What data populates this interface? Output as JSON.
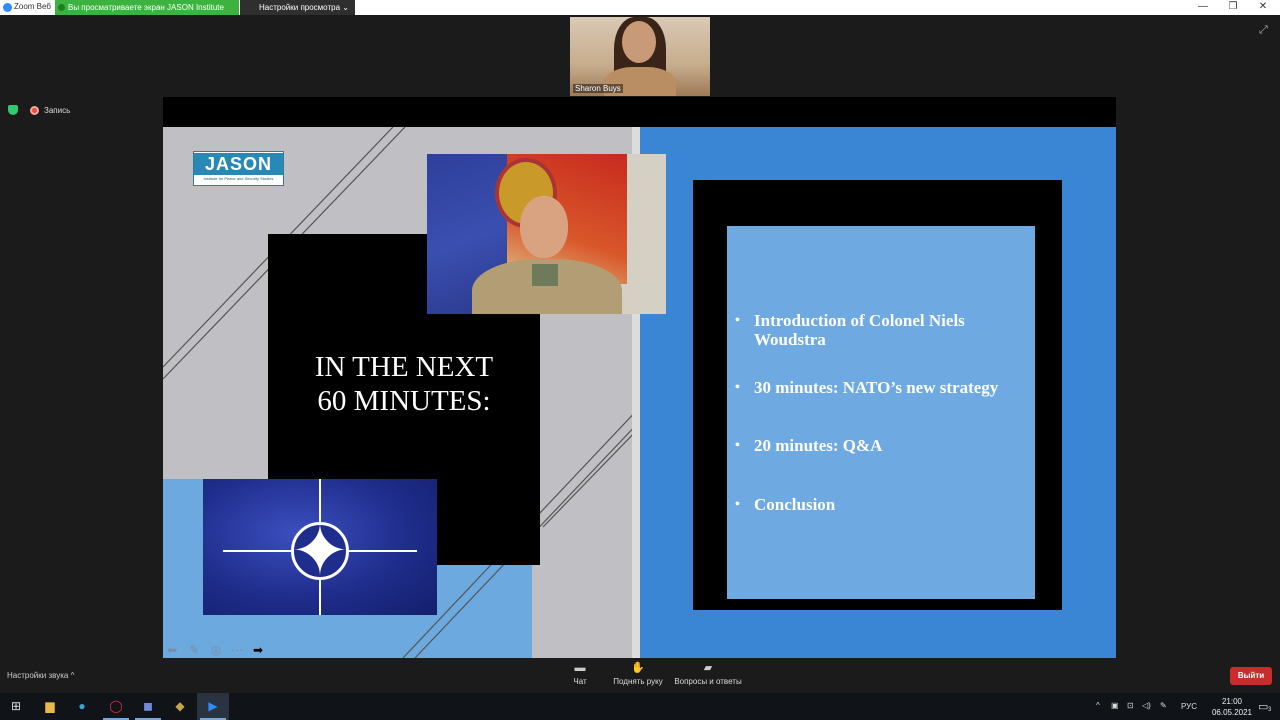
{
  "window": {
    "app_title": "Zoom Веб",
    "share_banner": "Вы просматриваете экран JASON Institute",
    "view_settings": "Настройки просмотра",
    "view_settings_chevron": "⌄",
    "minimize": "—",
    "maximize": "❐",
    "close": "✕"
  },
  "recording": {
    "label": "Запись"
  },
  "speaker": {
    "name": "Sharon Buys"
  },
  "slide": {
    "logo_word": "JASON",
    "logo_subtitle": "Institute for Peace and Security Studies",
    "heading_line1": "IN THE NEXT",
    "heading_line2": "60 MINUTES:",
    "agenda": [
      {
        "bullet": "•",
        "text": "Introduction of Colonel Niels Woudstra"
      },
      {
        "bullet": "•",
        "text": "30 minutes: NATO’s new strategy"
      },
      {
        "bullet": "•",
        "text": "20 minutes: Q&A"
      },
      {
        "bullet": "•",
        "text": "Conclusion"
      }
    ],
    "nav_icons": [
      "back-arrow-icon",
      "pen-icon",
      "pointer-icon",
      "more-icon",
      "forward-arrow-icon"
    ]
  },
  "controls": {
    "audio_settings": "Настройки звука",
    "audio_chevron": "^",
    "chat": "Чат",
    "raise_hand": "Поднять руку",
    "qa": "Вопросы и ответы",
    "exit": "Выйти"
  },
  "taskbar": {
    "language": "РУС",
    "time": "21:00",
    "date": "06.05.2021",
    "notification_count": "3"
  },
  "colors": {
    "share_green": "#3cb33f",
    "slide_blue": "#3a86d4",
    "agenda_blue": "#6ea9e2",
    "exit_red": "#c62e2e"
  }
}
